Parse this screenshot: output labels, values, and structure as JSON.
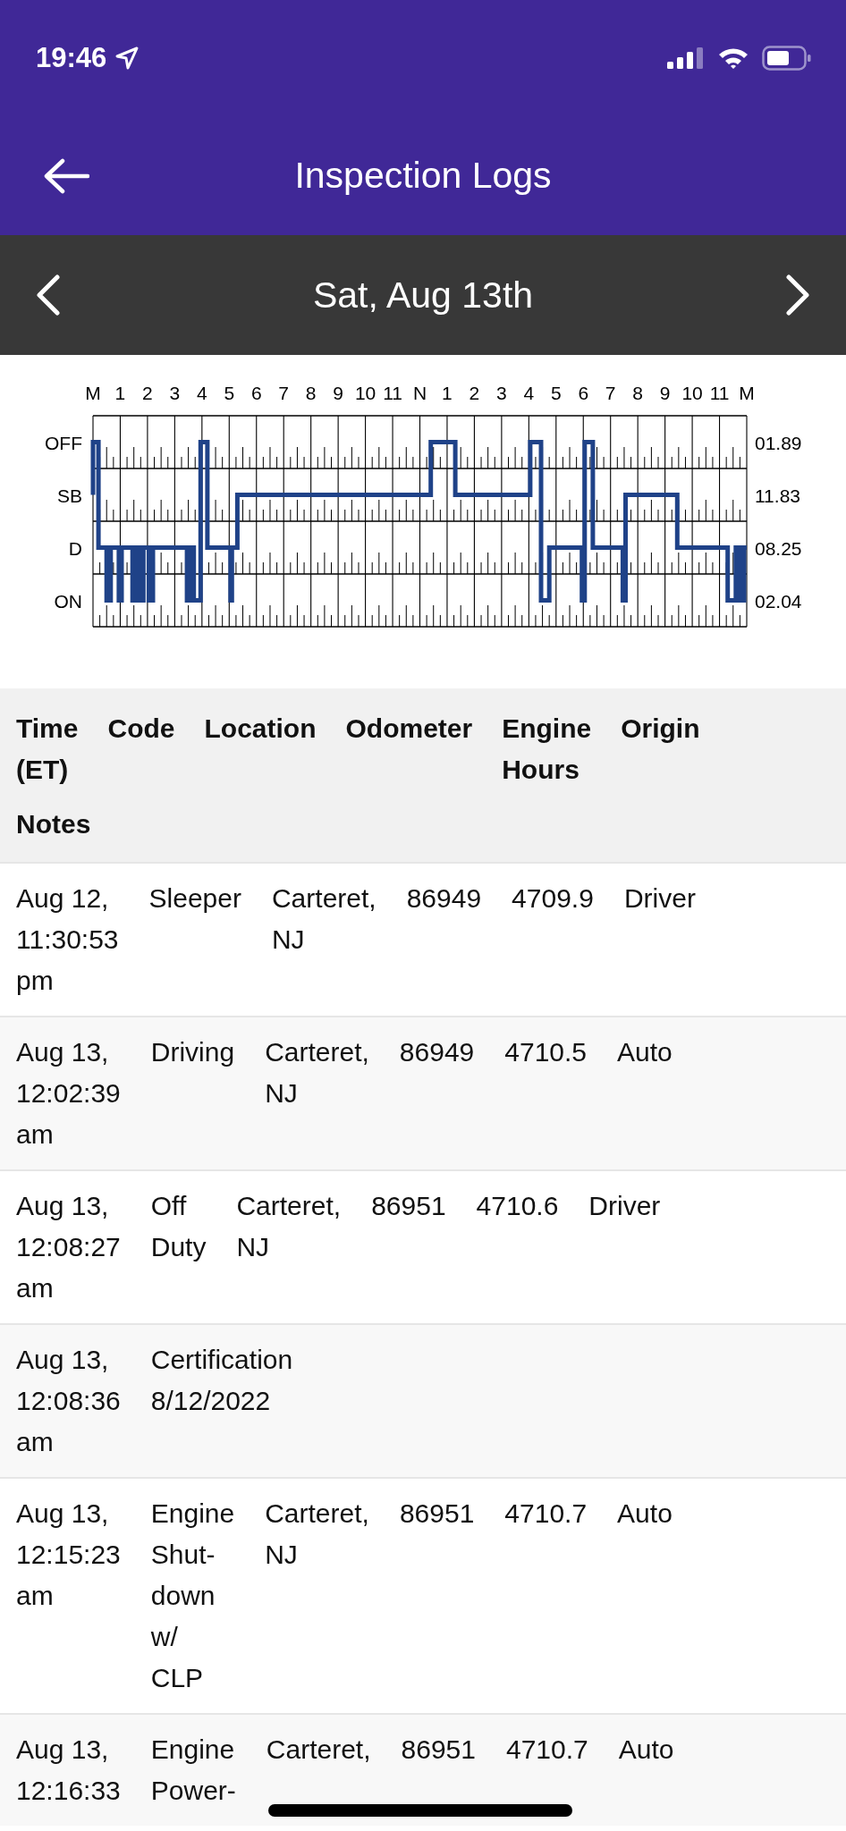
{
  "status_bar": {
    "time": "19:46"
  },
  "header": {
    "title": "Inspection Logs"
  },
  "date_bar": {
    "date": "Sat, Aug 13th"
  },
  "log_graph": {
    "hour_labels": [
      "M",
      "1",
      "2",
      "3",
      "4",
      "5",
      "6",
      "7",
      "8",
      "9",
      "10",
      "11",
      "N",
      "1",
      "2",
      "3",
      "4",
      "5",
      "6",
      "7",
      "8",
      "9",
      "10",
      "11",
      "M"
    ],
    "statuses": [
      {
        "label": "OFF",
        "total": "01.89"
      },
      {
        "label": "SB",
        "total": "11.83"
      },
      {
        "label": "D",
        "total": "08.25"
      },
      {
        "label": "ON",
        "total": "02.04"
      }
    ]
  },
  "table": {
    "columns": [
      "Time (ET)",
      "Code",
      "Location",
      "Odometer",
      "Engine Hours",
      "Origin"
    ],
    "notes_column": "Notes",
    "rows": [
      {
        "time": "Aug 12, 11:30:53 pm",
        "code": "Sleeper",
        "location": "Carteret, NJ",
        "odometer": "86949",
        "engine_hours": "4709.9",
        "origin": "Driver"
      },
      {
        "time": "Aug 13, 12:02:39 am",
        "code": "Driving",
        "location": "Carteret, NJ",
        "odometer": "86949",
        "engine_hours": "4710.5",
        "origin": "Auto"
      },
      {
        "time": "Aug 13, 12:08:27 am",
        "code": "Off Duty",
        "location": "Carteret, NJ",
        "odometer": "86951",
        "engine_hours": "4710.6",
        "origin": "Driver"
      },
      {
        "time": "Aug 13, 12:08:36 am",
        "code": "Certification 8/12/2022"
      },
      {
        "time": "Aug 13, 12:15:23 am",
        "code": "Engine Shut-down w/ CLP",
        "location": "Carteret, NJ",
        "odometer": "86951",
        "engine_hours": "4710.7",
        "origin": "Auto"
      },
      {
        "time": "Aug 13, 12:16:33",
        "code": "Engine Power-",
        "location": "Carteret,",
        "odometer": "86951",
        "engine_hours": "4710.7",
        "origin": "Auto"
      }
    ]
  }
}
